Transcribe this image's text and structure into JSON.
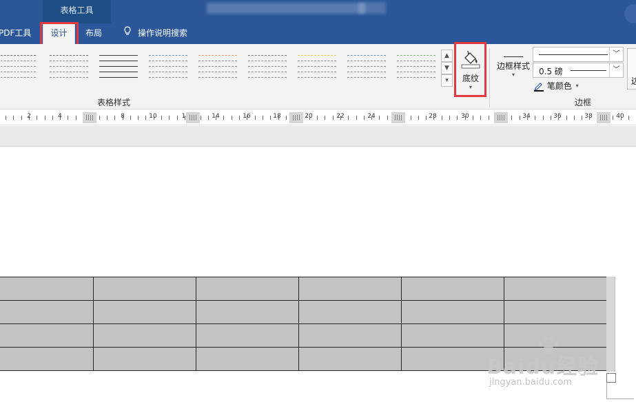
{
  "titlebar": {
    "context_tab": "表格工具",
    "colors": {
      "bar": "#2b579a",
      "context": "#1f4e86"
    }
  },
  "tabs": {
    "pdf": "PDF工具",
    "design": "设计",
    "layout": "布局",
    "search": "操作说明搜索",
    "search_icon": "lightbulb-icon",
    "active": "design"
  },
  "ribbon": {
    "table_styles_group_label": "表格样式",
    "table_style_accents": [
      "#6d6d6d",
      "#6d6d6d",
      "#3f3f3f",
      "#6f8fc8",
      "#e59a66",
      "#7a7a7a",
      "#f2c14e",
      "#6f8fc8",
      "#7fb06a"
    ],
    "shading_label": "底纹",
    "shading_icon": "paint-bucket-icon",
    "border_styles_label": "边框样式",
    "line_weight": "0.5 磅",
    "pen_color_label": "笔颜色",
    "borders_group_label": "边框",
    "border_painter_partial": "边"
  },
  "ruler": {
    "labels": [
      "2",
      "4",
      "8",
      "10",
      "1:",
      "14",
      "16",
      "18",
      "20",
      "22",
      "24",
      "28",
      "30",
      "34",
      "36",
      "38",
      "40"
    ]
  },
  "table": {
    "rows": 4,
    "columns": 6,
    "cell_fill": "#c4c4c4"
  },
  "highlight_color": "#e0393f",
  "watermark": {
    "main": "Baidu经验",
    "sub": "jingyan.baidu.com"
  }
}
